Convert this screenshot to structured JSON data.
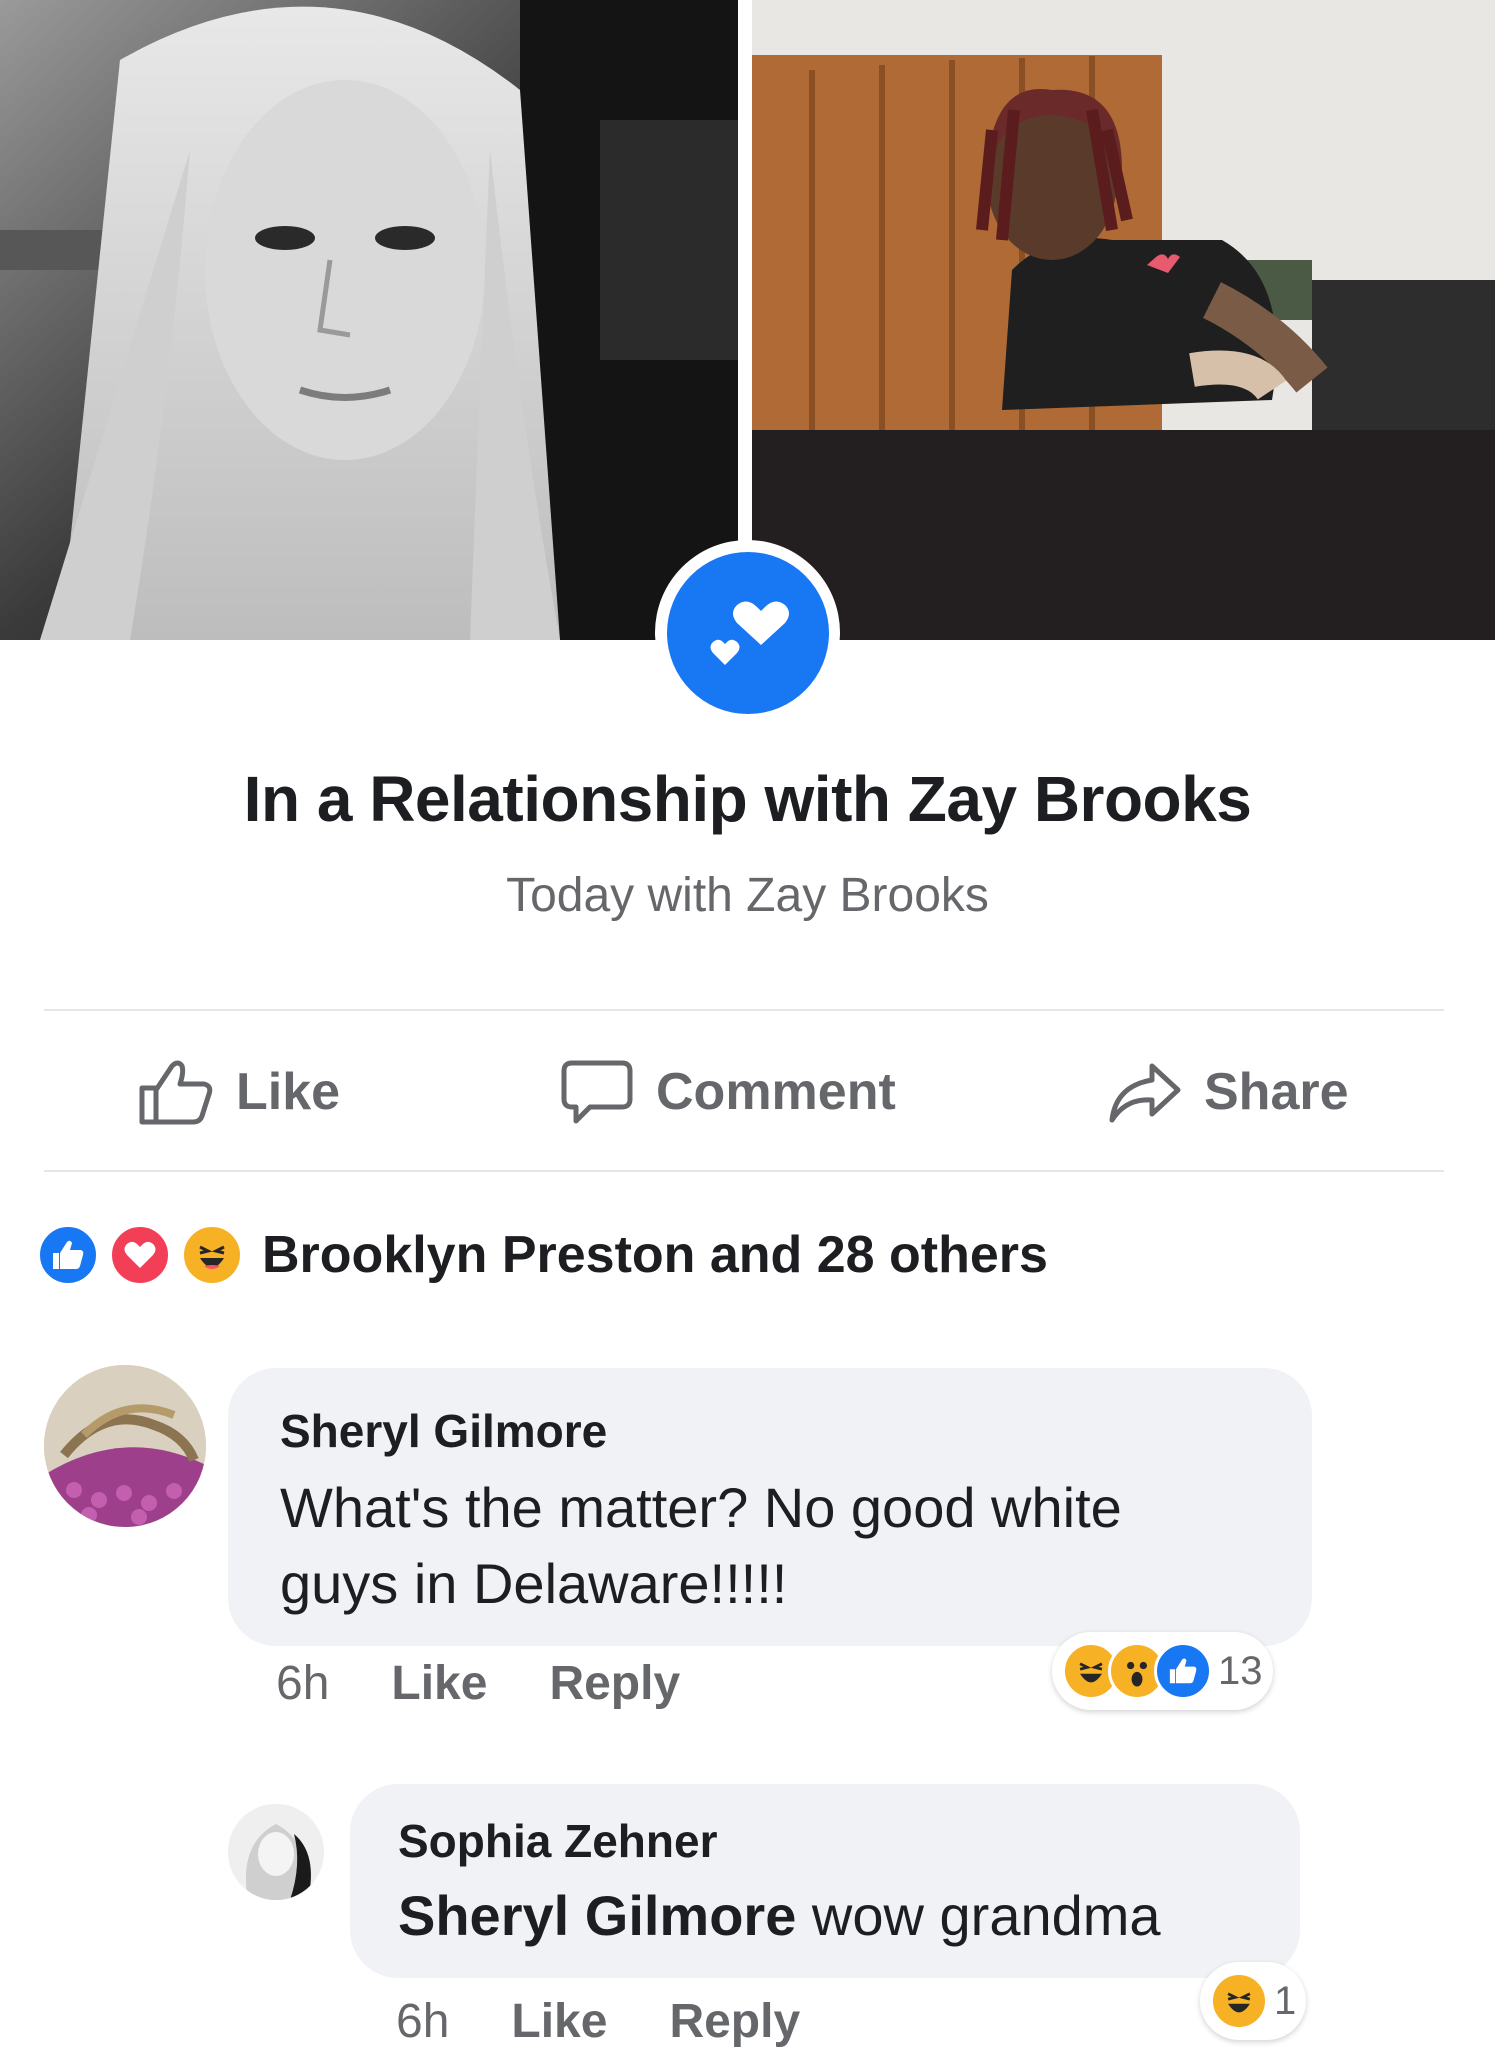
{
  "post": {
    "title": "In a Relationship with Zay Brooks",
    "subtitle": "Today with Zay Brooks"
  },
  "actions": {
    "like": "Like",
    "comment": "Comment",
    "share": "Share"
  },
  "reactions_summary": {
    "text": "Brooklyn Preston and 28 others",
    "icons": [
      "like-icon",
      "love-icon",
      "haha-icon"
    ]
  },
  "comments": [
    {
      "name": "Sheryl Gilmore",
      "line1": "What's the matter? No good white",
      "line2": "guys in Delaware!!!!!",
      "time": "6h",
      "like": "Like",
      "reply": "Reply",
      "reaction_count": "13",
      "reaction_icons": [
        "haha-icon",
        "wow-icon",
        "like-icon"
      ]
    },
    {
      "name": "Sophia Zehner",
      "mention": "Sheryl Gilmore",
      "text": " wow grandma",
      "time": "6h",
      "like": "Like",
      "reply": "Reply",
      "reaction_count": "1",
      "reaction_icons": [
        "haha-icon"
      ]
    }
  ],
  "colors": {
    "accent": "#1877f2",
    "love": "#f33e58",
    "haha": "#f7b125",
    "text_secondary": "#65676b",
    "bubble": "#f0f2f5"
  }
}
